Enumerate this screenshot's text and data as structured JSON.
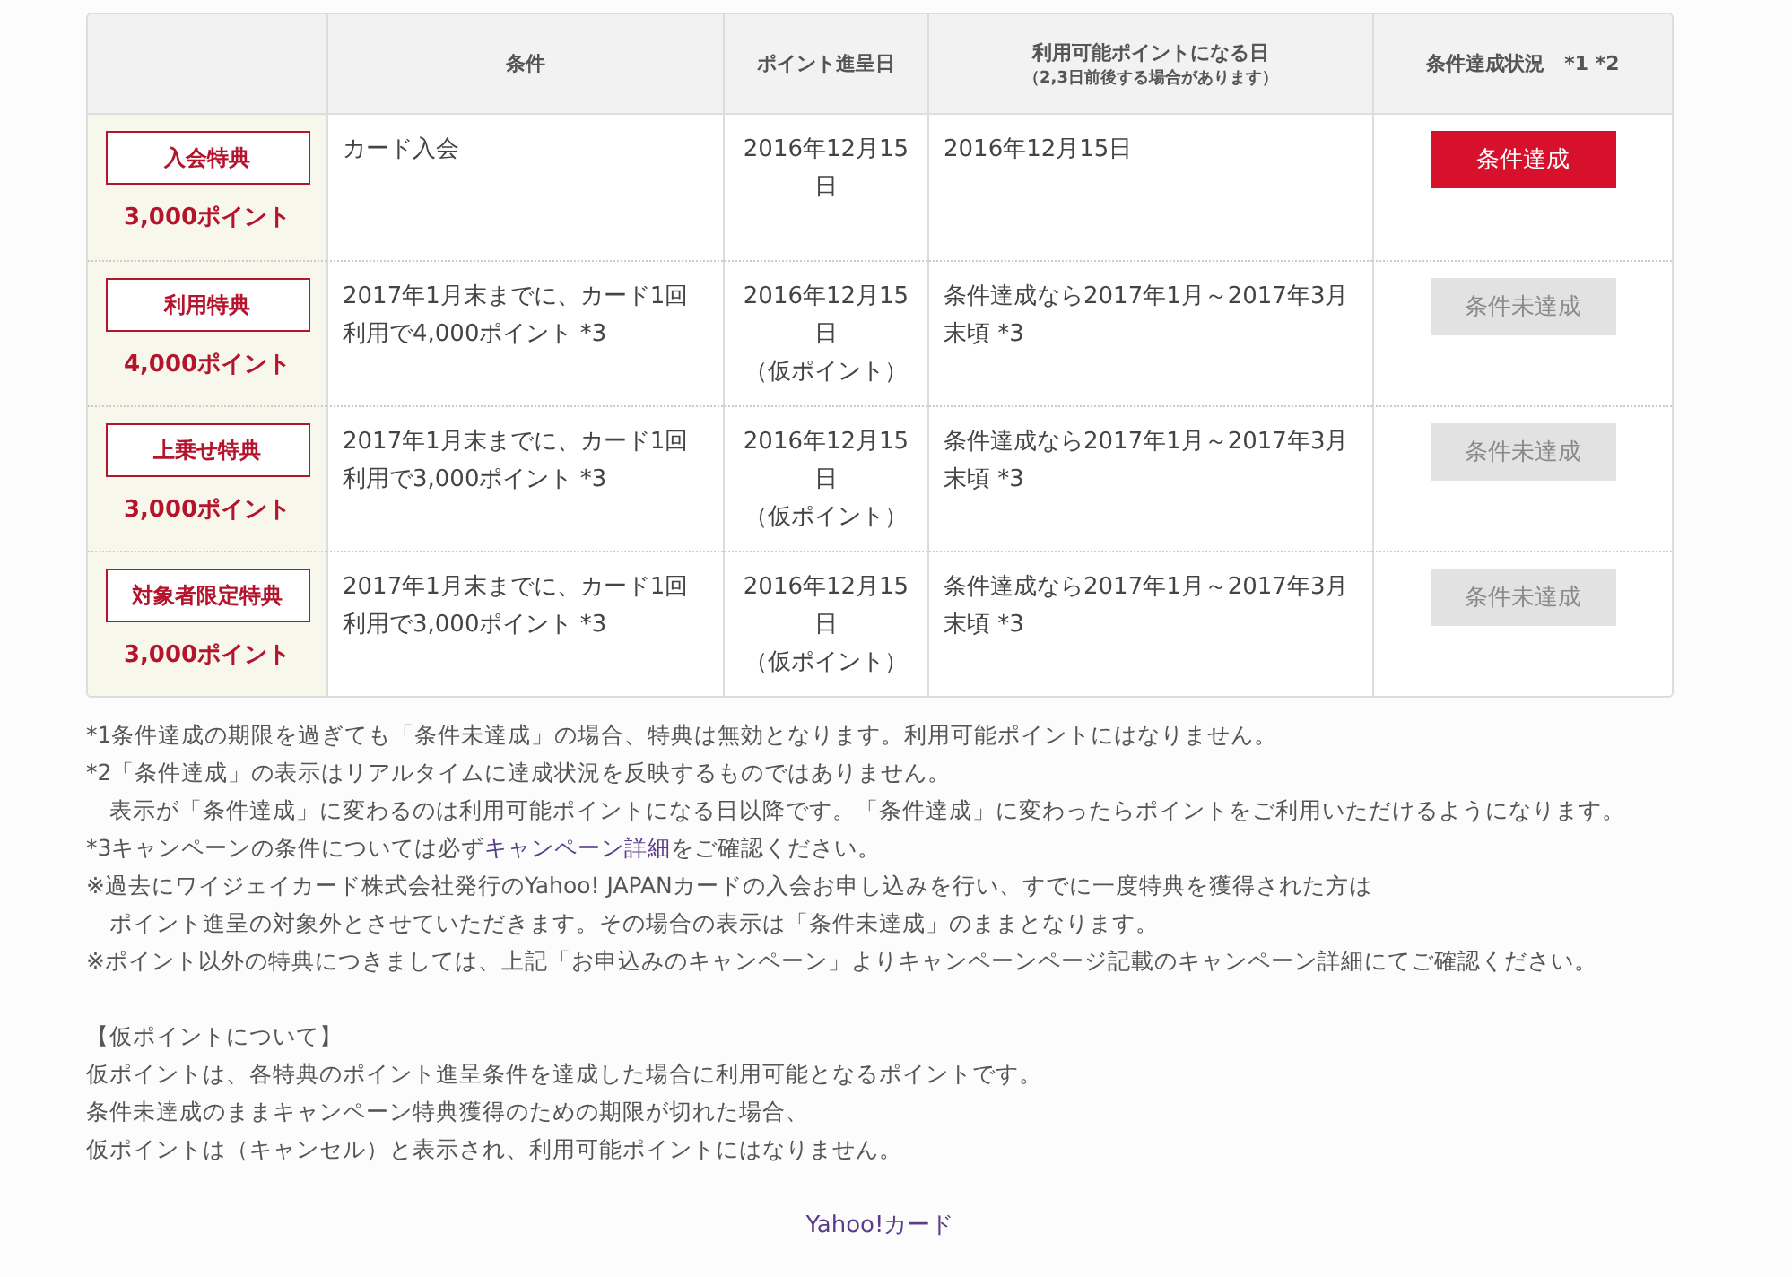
{
  "table": {
    "columns": {
      "condition": "条件",
      "grant_date": "ポイント進呈日",
      "usable_date": {
        "label": "利用可能ポイントになる日",
        "sub": "（2,3日前後する場合があります）"
      },
      "status": "条件達成状況　*1 *2"
    },
    "rows": [
      {
        "benefit": "入会特典",
        "points": "3,000ポイント",
        "condition": "カード入会",
        "grant_date": "2016年12月15日",
        "usable_date": "2016年12月15日",
        "status": "条件達成",
        "achieved": true
      },
      {
        "benefit": "利用特典",
        "points": "4,000ポイント",
        "condition": "2017年1月末までに、カード1回利用で4,000ポイント *3",
        "grant_date": "2016年12月15日",
        "grant_note": "（仮ポイント）",
        "usable_date": "条件達成なら2017年1月～2017年3月末頃 *3",
        "status": "条件未達成",
        "achieved": false
      },
      {
        "benefit": "上乗せ特典",
        "points": "3,000ポイント",
        "condition": "2017年1月末までに、カード1回利用で3,000ポイント *3",
        "grant_date": "2016年12月15日",
        "grant_note": "（仮ポイント）",
        "usable_date": "条件達成なら2017年1月～2017年3月末頃 *3",
        "status": "条件未達成",
        "achieved": false
      },
      {
        "benefit": "対象者限定特典",
        "points": "3,000ポイント",
        "condition": "2017年1月末までに、カード1回利用で3,000ポイント *3",
        "grant_date": "2016年12月15日",
        "grant_note": "（仮ポイント）",
        "usable_date": "条件達成なら2017年1月～2017年3月末頃 *3",
        "status": "条件未達成",
        "achieved": false
      }
    ]
  },
  "notes": [
    {
      "text": "*1条件達成の期限を過ぎても「条件未達成」の場合、特典は無効となります。利用可能ポイントにはなりません。",
      "indent": false
    },
    {
      "text": "*2「条件達成」の表示はリアルタイムに達成状況を反映するものではありません。",
      "indent": false
    },
    {
      "text": "表示が「条件達成」に変わるのは利用可能ポイントになる日以降です。「条件達成」に変わったらポイントをご利用いただけるようになります。",
      "indent": true
    },
    {
      "text": "*3キャンペーンの条件については必ず",
      "link": "キャンペーン詳細",
      "after": "をご確認ください。",
      "indent": false
    },
    {
      "text": "※過去にワイジェイカード株式会社発行のYahoo! JAPANカードの入会お申し込みを行い、すでに一度特典を獲得された方は",
      "indent": false
    },
    {
      "text": "ポイント進呈の対象外とさせていただきます。その場合の表示は「条件未達成」のままとなります。",
      "indent": true
    },
    {
      "text": "※ポイント以外の特典につきましては、上記「お申込みのキャンペーン」よりキャンペーンページ記載のキャンペーン詳細にてご確認ください。",
      "indent": false
    }
  ],
  "provisional": {
    "heading": "【仮ポイントについて】",
    "lines": [
      "仮ポイントは、各特典のポイント進呈条件を達成した場合に利用可能となるポイントです。",
      "条件未達成のままキャンペーン特典獲得のための期限が切れた場合、",
      "仮ポイントは（キャンセル）と表示され、利用可能ポイントにはなりません。"
    ]
  },
  "footer": {
    "link": "Yahoo!カード"
  }
}
